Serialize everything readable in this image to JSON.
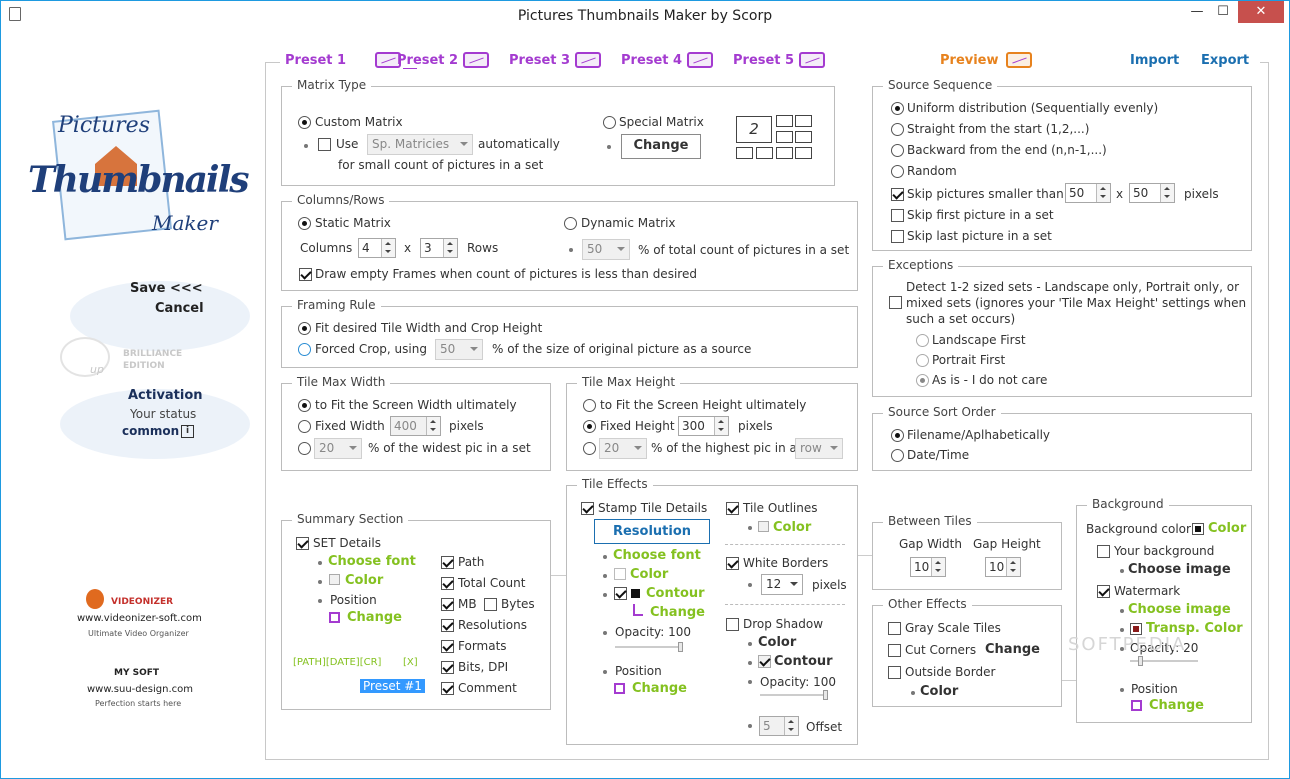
{
  "window": {
    "title": "Pictures Thumbnails Maker by Scorp",
    "min": "—",
    "max": "☐",
    "close": "✕"
  },
  "tabs": {
    "p1": "Preset 1",
    "p2": "Preset 2",
    "p3": "Preset 3",
    "p4": "Preset 4",
    "p5": "Preset 5",
    "preview": "Preview",
    "import": "Import",
    "export": "Export"
  },
  "sidebar": {
    "logo1": "Pictures",
    "logo2": "Thumbnails",
    "logo3": "Maker",
    "save": "Save <<<",
    "cancel": "Cancel",
    "edition1": "BRILLIANCE",
    "edition2": "EDITION",
    "up": "up",
    "activation": "Activation",
    "status_label": "Your status",
    "status_value": "common",
    "info": "i",
    "vid_name": "VIDEONIZER",
    "vid_url": "www.videonizer-soft.com",
    "vid_tag": "Ultimate Video Organizer",
    "my_name": "MY SOFT",
    "my_url": "www.suu-design.com",
    "my_tag": "Perfection starts here"
  },
  "matrix": {
    "title": "Matrix Type",
    "custom": "Custom Matrix",
    "use": "Use",
    "sp": "Sp. Matricies",
    "auto": "automatically",
    "small": "for small count of pictures in a set",
    "special": "Special Matrix",
    "change": "Change",
    "num": "2"
  },
  "colrows": {
    "title": "Columns/Rows",
    "static": "Static Matrix",
    "dynamic": "Dynamic Matrix",
    "columns": "Columns",
    "cols_val": "4",
    "x": "x",
    "rows_val": "3",
    "rows": "Rows",
    "pct_val": "50",
    "pct_label": "% of total count of pictures in a set",
    "empty": "Draw empty Frames when count of pictures is less than desired"
  },
  "framing": {
    "title": "Framing Rule",
    "fit": "Fit desired Tile Width and Crop Height",
    "forced": "Forced Crop, using",
    "val": "50",
    "label": "% of the size of original picture as a source"
  },
  "tilewidth": {
    "title": "Tile Max Width",
    "fit": "to Fit the Screen Width ultimately",
    "fixed": "Fixed Width",
    "fixed_val": "400",
    "pixels": "pixels",
    "pct_val": "20",
    "pct": "% of the widest pic in a set"
  },
  "tileheight": {
    "title": "Tile Max Height",
    "fit": "to Fit the Screen Height ultimately",
    "fixed": "Fixed Height",
    "fixed_val": "300",
    "pixels": "pixels",
    "pct_val": "20",
    "pct": "% of the highest pic in a",
    "row": "row"
  },
  "source": {
    "title": "Source Sequence",
    "uniform": "Uniform distribution (Sequentially evenly)",
    "straight": "Straight from the start (1,2,...)",
    "backward": "Backward from the end (n,n-1,...)",
    "random": "Random",
    "skip_small": "Skip pictures smaller than",
    "w": "50",
    "x": "x",
    "h": "50",
    "pixels": "pixels",
    "skip_first": "Skip first picture in a set",
    "skip_last": "Skip last picture in a set"
  },
  "exceptions": {
    "title": "Exceptions",
    "l1": "Detect 1-2 sized sets - Landscape only, Portrait only, or",
    "l2": "mixed sets (ignores your 'Tile Max Height' settings when",
    "l3": "such a set occurs)",
    "landscape": "Landscape First",
    "portrait": "Portrait First",
    "asis": "As is - I do not care"
  },
  "sort": {
    "title": "Source Sort Order",
    "filename": "Filename/Aplhabetically",
    "date": "Date/Time"
  },
  "summary": {
    "title": "Summary Section",
    "set": "SET Details",
    "font": "Choose font",
    "color": "Color",
    "position": "Position",
    "change": "Change",
    "path": "Path",
    "total": "Total Count",
    "mb": "MB",
    "bytes": "Bytes",
    "res": "Resolutions",
    "formats": "Formats",
    "bits": "Bits, DPI",
    "comment": "Comment",
    "tags": "[PATH][DATE][CR]",
    "xtag": "[X]",
    "preset": "Preset #1"
  },
  "tile": {
    "title": "Tile Effects",
    "stamp": "Stamp Tile Details",
    "resolution": "Resolution",
    "font": "Choose font",
    "color": "Color",
    "contour": "Contour",
    "change": "Change",
    "opacity": "Opacity: 100",
    "position": "Position",
    "outlines": "Tile Outlines",
    "ocolor": "Color",
    "white": "White Borders",
    "wb_val": "12",
    "pixels": "pixels",
    "drop": "Drop Shadow",
    "dcolor": "Color",
    "dcontour": "Contour",
    "dopacity": "Opacity: 100",
    "offset_val": "5",
    "offset": "Offset"
  },
  "between": {
    "title": "Between Tiles",
    "gw": "Gap Width",
    "gh": "Gap Height",
    "gw_val": "10",
    "gh_val": "10"
  },
  "other": {
    "title": "Other Effects",
    "gray": "Gray Scale Tiles",
    "corners": "Cut Corners",
    "change": "Change",
    "outside": "Outside Border",
    "color": "Color"
  },
  "background": {
    "title": "Background",
    "bgcolor": "Background color",
    "color": "Color",
    "yours": "Your background",
    "choose": "Choose image",
    "watermark": "Watermark",
    "wchoose": "Choose image",
    "transp": "Transp. Color",
    "opacity": "Opacity: 20",
    "position": "Position",
    "change": "Change"
  },
  "watermark_text": "SOFTPEDIA",
  "colors": {
    "purple": "#a43bd0",
    "orange": "#e7821d",
    "blue": "#1b6fb0",
    "green": "#84c120"
  }
}
